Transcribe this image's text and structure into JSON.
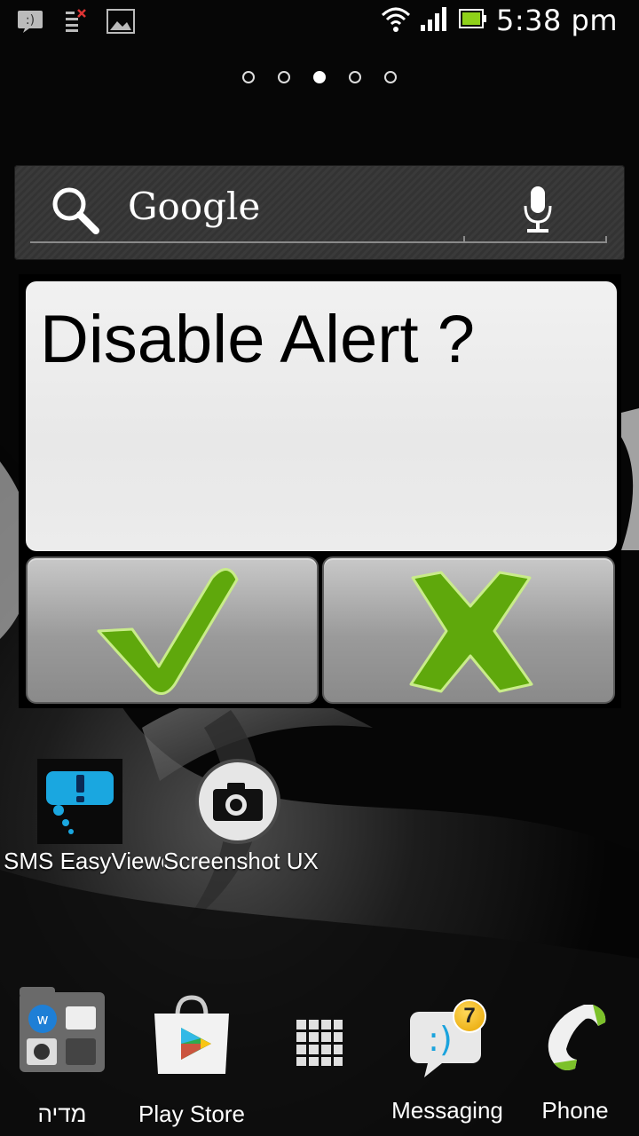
{
  "status_bar": {
    "time": "5:38 pm",
    "icons": [
      "sms-notification-icon",
      "task-list-icon",
      "image-icon",
      "wifi-icon",
      "signal-icon",
      "battery-icon"
    ]
  },
  "home": {
    "page_count": 5,
    "active_page": 3
  },
  "search_widget": {
    "brand": "Google",
    "icons": [
      "search-icon",
      "microphone-icon"
    ]
  },
  "alert": {
    "title": "Disable Alert ?",
    "confirm_icon": "checkmark-icon",
    "cancel_icon": "x-icon",
    "accent_color": "#6ab20f"
  },
  "shortcuts": [
    {
      "label": "SMS EasyViewer",
      "icon": "sms-easyviewer-icon"
    },
    {
      "label": "Screenshot UX",
      "icon": "camera-icon"
    }
  ],
  "dock": {
    "items": [
      {
        "label": "מדיה",
        "icon": "media-folder-icon"
      },
      {
        "label": "Play Store",
        "icon": "play-store-icon"
      },
      {
        "label": "",
        "icon": "app-drawer-icon"
      },
      {
        "label": "Messaging",
        "icon": "messaging-icon",
        "badge": "7"
      },
      {
        "label": "Phone",
        "icon": "phone-icon"
      }
    ]
  }
}
